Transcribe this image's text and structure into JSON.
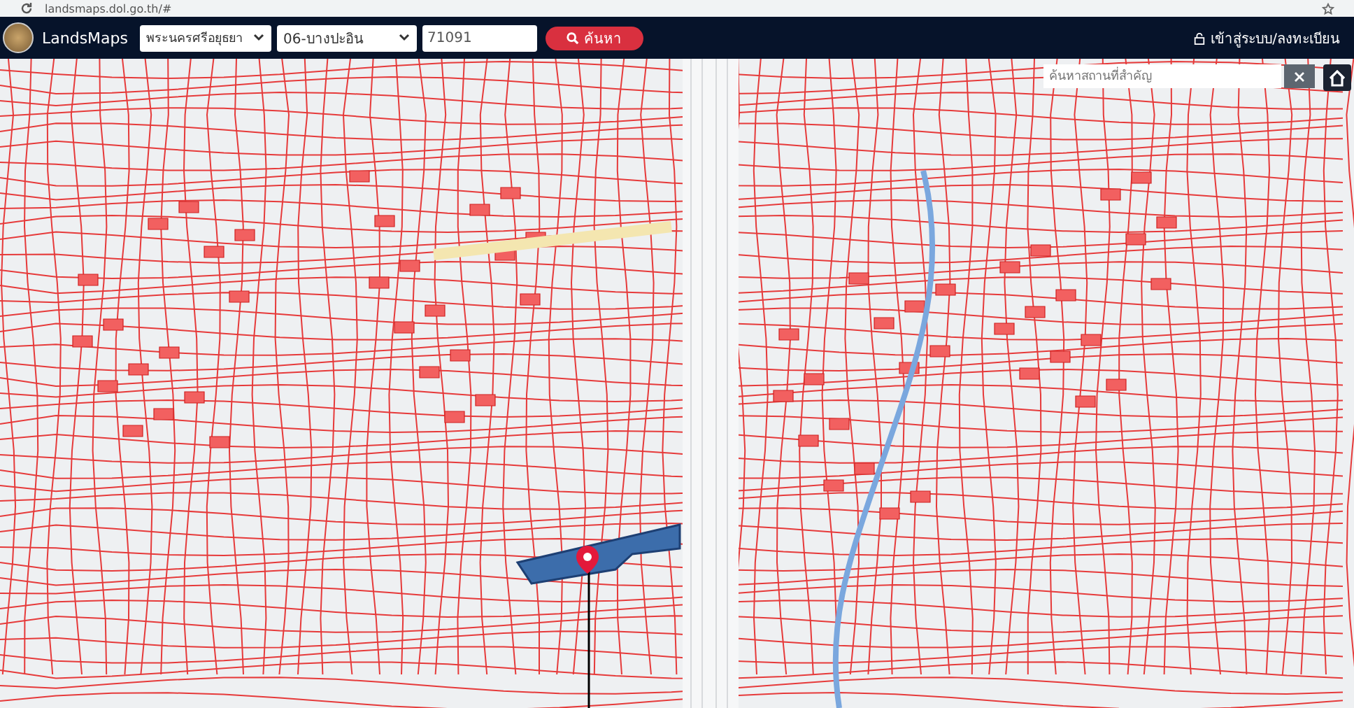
{
  "browser": {
    "url": "landsmaps.dol.go.th/#"
  },
  "header": {
    "logo_text": "LandsMaps",
    "province_select": {
      "value": "พระนครศรีอยุธยา"
    },
    "district_select": {
      "value": "06-บางปะอิน"
    },
    "parcel_field": {
      "value": "71091"
    },
    "search_button": {
      "label": "ค้นหา"
    },
    "login_link": {
      "label": "เข้าสู่ระบบ/ลงทะเบียน"
    }
  },
  "map": {
    "search": {
      "placeholder": "ค้นหาสถานที่สำคัญ"
    }
  }
}
